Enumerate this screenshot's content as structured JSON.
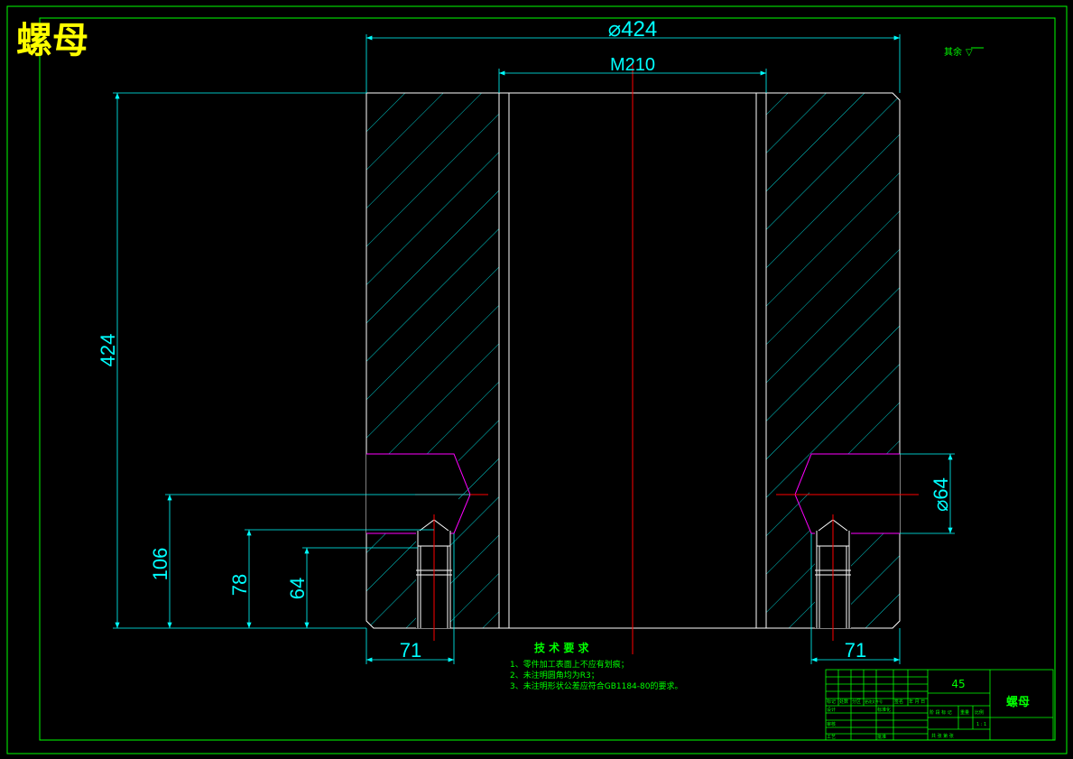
{
  "title": "螺母",
  "surface_note": "其余",
  "surface_symbol": "▽",
  "dimensions": {
    "outer_diameter": "⌀424",
    "thread": "M210",
    "height": "424",
    "hole_diameter": "⌀64",
    "h106": "106",
    "h78": "78",
    "h64": "64",
    "left_width": "71",
    "right_width": "71"
  },
  "tech_requirements": {
    "heading": "技 术 要 求",
    "items": [
      "1、零件加工表面上不应有划痕；",
      "2、未注明圆角均为R3；",
      "3、未注明形状公差应符合GB1184-80的要求。"
    ]
  },
  "title_block": {
    "material": "45",
    "part_name": "螺母",
    "row_labels": [
      "标记",
      "处数",
      "分区",
      "更改文件号",
      "签名",
      "年 月 日"
    ],
    "left_labels": [
      "设计",
      "审核",
      "工艺"
    ],
    "mid_labels": [
      "标准化",
      "批准"
    ],
    "stage_labels": [
      "阶 段 标 记",
      "重量",
      "比例"
    ],
    "scale": "1 : 1",
    "sheet_label": "共 张 第 张"
  },
  "colors": {
    "border": "#00ff00",
    "outline": "#ffffff",
    "hatch": "#00ffff",
    "dimension": "#00ffff",
    "centerline": "#ff0000",
    "hole_detail": "#ff00ff",
    "title": "#ffff00",
    "text_green": "#00ff00"
  }
}
